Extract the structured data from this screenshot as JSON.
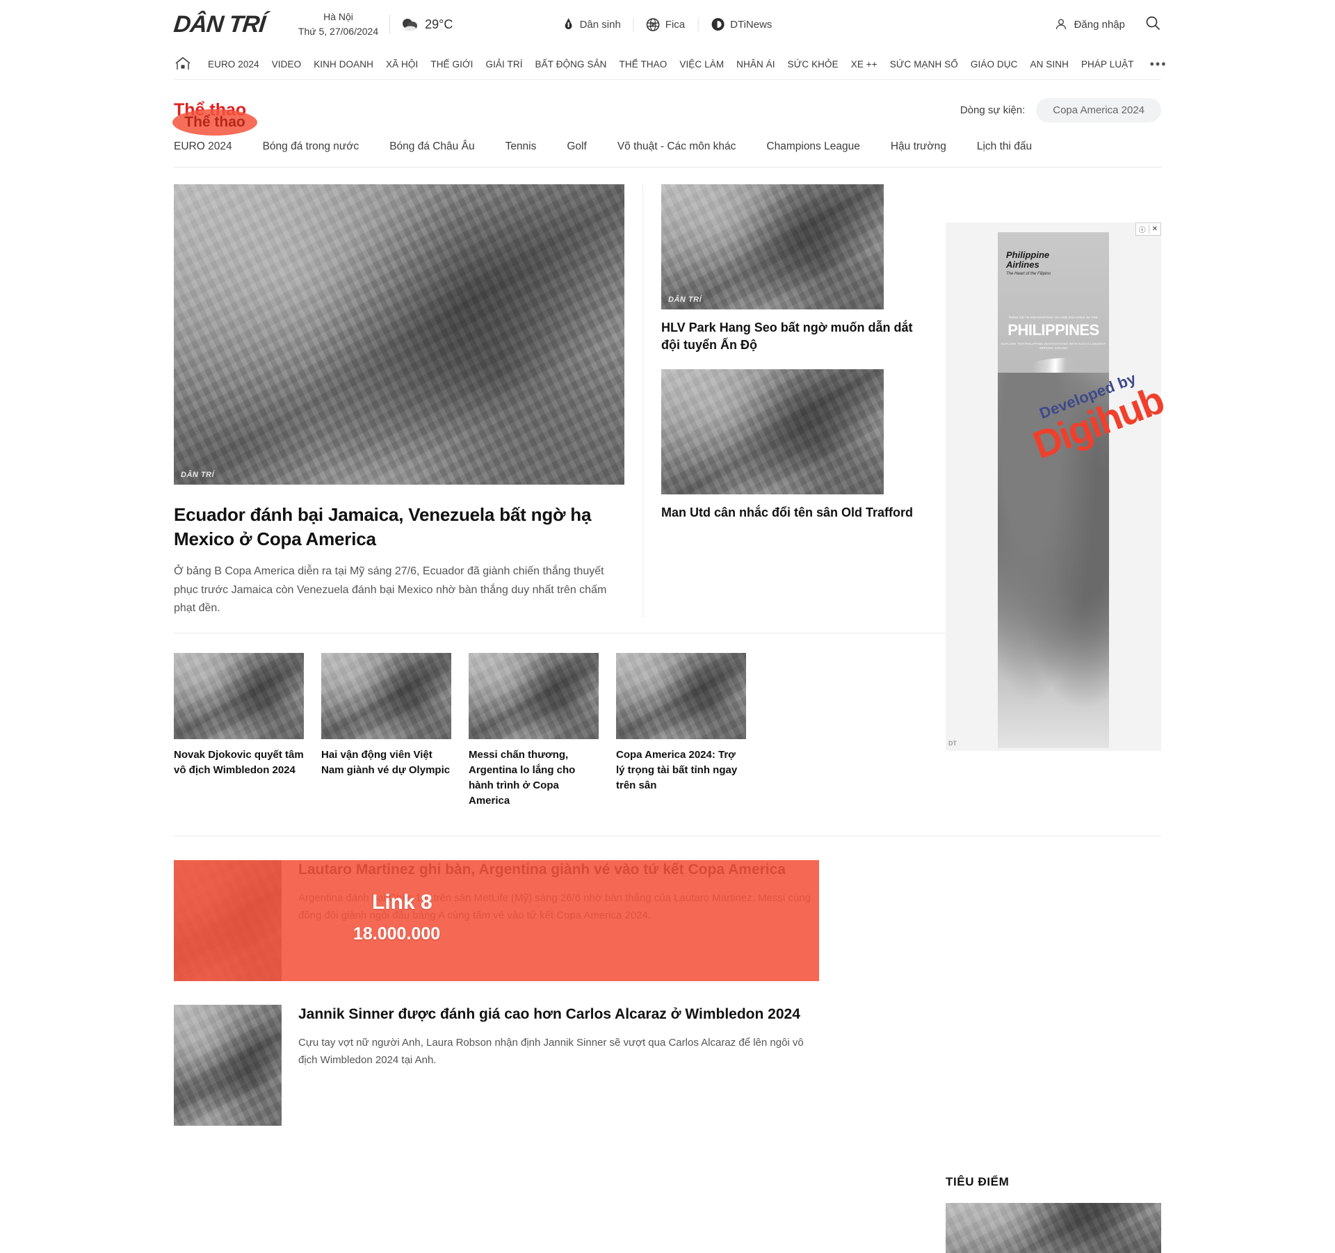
{
  "header": {
    "logo": "DÂN TRÍ",
    "city": "Hà Nội",
    "date": "Thứ 5, 27/06/2024",
    "temperature": "29°C",
    "weather_icon": "cloud-icon",
    "brand_links": [
      {
        "label": "Dân sinh",
        "icon": "pen-drop-icon"
      },
      {
        "label": "Fica",
        "icon": "globe-icon"
      },
      {
        "label": "DTiNews",
        "icon": "d-circle-icon"
      }
    ],
    "login_label": "Đăng nhập",
    "login_icon": "user-icon",
    "search_icon": "search-icon"
  },
  "nav": {
    "home_icon": "home-icon",
    "items": [
      "EURO 2024",
      "VIDEO",
      "KINH DOANH",
      "XÃ HỘI",
      "THẾ GIỚI",
      "GIẢI TRÍ",
      "BẤT ĐỘNG SẢN",
      "THỂ THAO",
      "VIỆC LÀM",
      "NHÂN ÁI",
      "SỨC KHỎE",
      "XE ++",
      "SỨC MẠNH SỐ",
      "GIÁO DỤC",
      "AN SINH",
      "PHÁP LUẬT"
    ],
    "more": "•••"
  },
  "section": {
    "title": "Thể thao",
    "highlight_label": "Thể thao",
    "highlight_color": "#f4533c",
    "event_label": "Dòng sự kiện:",
    "event_chip": "Copa America 2024"
  },
  "subnav": {
    "items": [
      "EURO 2024",
      "Bóng đá trong nước",
      "Bóng đá Châu Âu",
      "Tennis",
      "Golf",
      "Võ thuật - Các môn khác",
      "Champions League",
      "Hậu trường",
      "Lịch thi đấu"
    ]
  },
  "lead": {
    "image_label": "DÂN TRÍ",
    "title": "Ecuador đánh bại Jamaica, Venezuela bất ngờ hạ Mexico ở Copa America",
    "desc": "Ở bảng B Copa America diễn ra tại Mỹ sáng 27/6, Ecuador đã giành chiến thắng thuyết phục trước Jamaica còn Venezuela đánh bại Mexico nhờ bàn thắng duy nhất trên chấm phạt đền."
  },
  "side_articles": [
    {
      "title": "HLV Park Hang Seo bất ngờ muốn dẫn dắt đội tuyển Ấn Độ",
      "image_label": "DÂN TRÍ"
    },
    {
      "title": "Man Utd cân nhắc đổi tên sân Old Trafford",
      "image_label": ""
    }
  ],
  "cards": [
    {
      "title": "Novak Djokovic quyết tâm vô địch Wimbledon 2024"
    },
    {
      "title": "Hai vận động viên Việt Nam giành vé dự Olympic"
    },
    {
      "title": "Messi chấn thương, Argentina lo lắng cho hành trình ở Copa America"
    },
    {
      "title": "Copa America 2024: Trợ lý trọng tài bất tỉnh ngay trên sân"
    }
  ],
  "features": [
    {
      "title": "Lautaro Martinez ghi bàn, Argentina giành vé vào tứ kết Copa America",
      "desc": "Argentina đánh bại Chile 1-0 trên sân MetLife (Mỹ) sáng 26/6 nhờ bàn thắng của Lautaro Martinez. Messi cùng đồng đội giành ngôi đầu bảng A cùng tấm vé vào tứ kết Copa America 2024.",
      "overlay": {
        "line1": "Link 8",
        "line2": "18.000.000"
      }
    },
    {
      "title": "Jannik Sinner được đánh giá cao hơn Carlos Alcaraz ở Wimbledon 2024",
      "desc": "Cựu tay vợt nữ người Anh, Laura Robson nhận định Jannik Sinner sẽ vượt qua Carlos Alcaraz để lên ngôi vô địch Wimbledon 2024 tại Anh."
    }
  ],
  "ad": {
    "info_icon": "info-icon",
    "close_icon": "close-icon",
    "brand_line1": "Philippine",
    "brand_line2": "Airlines",
    "tagline": "The Heart of the Filipino",
    "kicker": "INDULGE IN ENCHANTING ISLAND ESCAPES IN THE",
    "headline": "PHILIPPINES",
    "subline": "EXPLORE TOP PHILIPPINE DESTINATIONS WITH ASIA'S LONGEST SERVING AIRLINE",
    "watermark": "DT"
  },
  "watermark": {
    "developed_by": "Developed by",
    "brand": "Digihub"
  },
  "rail": {
    "tieudiem_title": "TIÊU ĐIỂM"
  }
}
